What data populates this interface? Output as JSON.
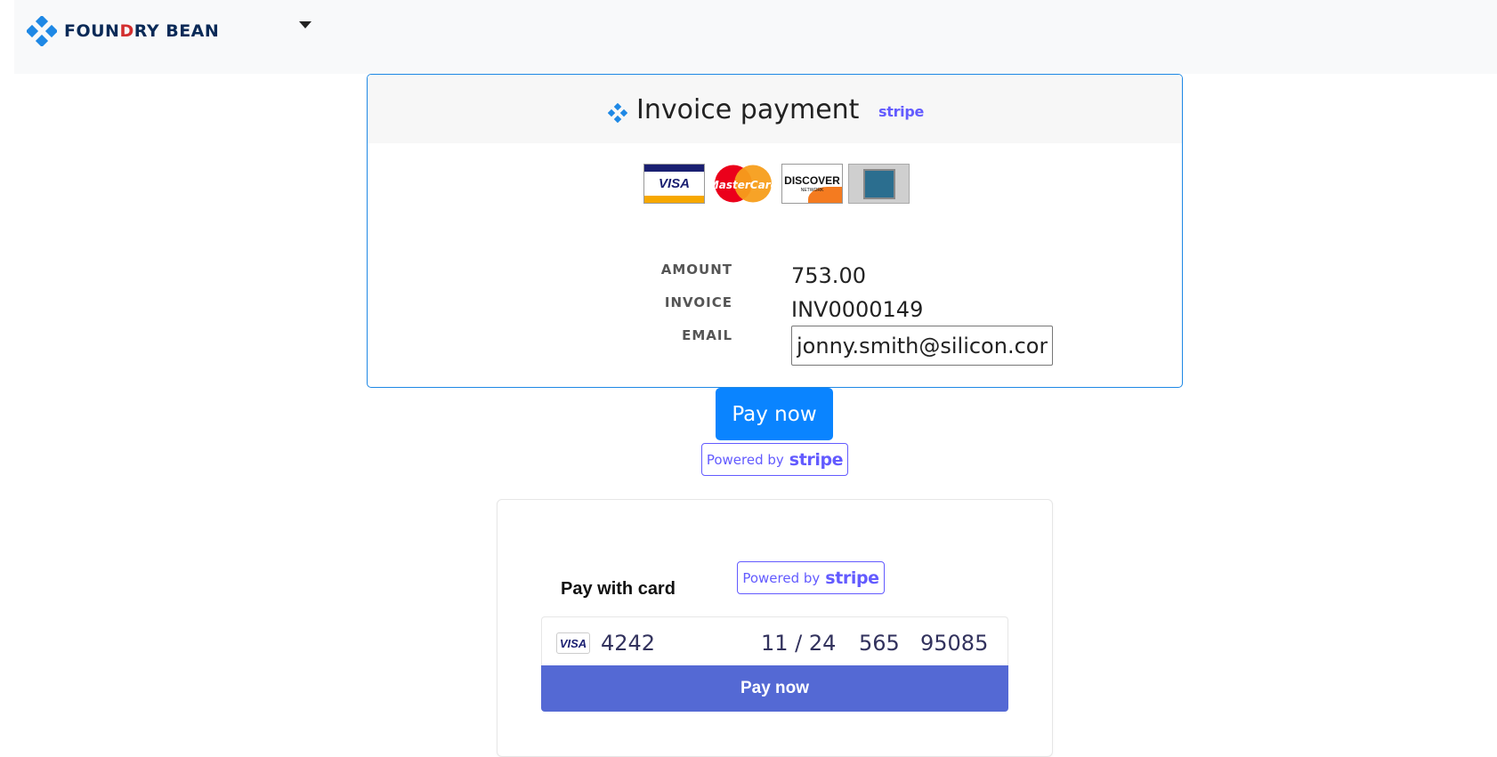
{
  "navbar": {
    "brand_prefix": "FOUN",
    "brand_o": "D",
    "brand_suffix": "RY BEAN"
  },
  "invoice": {
    "title": "Invoice payment",
    "stripe_label": "stripe",
    "cards": {
      "visa": "VISA",
      "mastercard": "MasterCard",
      "discover": "DISCOVER",
      "discover_sub": "NETWORK"
    },
    "amount_label": "AMOUNT",
    "amount_value": "753.00",
    "invoice_label": "INVOICE",
    "invoice_value": "INV0000149",
    "email_label": "EMAIL",
    "email_value": "jonny.smith@silicon.com"
  },
  "actions": {
    "pay_now_label": "Pay now",
    "powered_by": "Powered by",
    "stripe_word": "stripe"
  },
  "stripe_form": {
    "heading": "Pay with card",
    "powered_by": "Powered by",
    "stripe_word": "stripe",
    "card_brand": "VISA",
    "card_number": "4242",
    "expiry": "11 / 24",
    "cvc": "565",
    "zip": "95085",
    "submit_label": "Pay now"
  },
  "colors": {
    "primary_button": "#0a84ff",
    "stripe_purple": "#635bff",
    "stripe_button": "#5469d4",
    "card_border": "#1e88e5"
  }
}
